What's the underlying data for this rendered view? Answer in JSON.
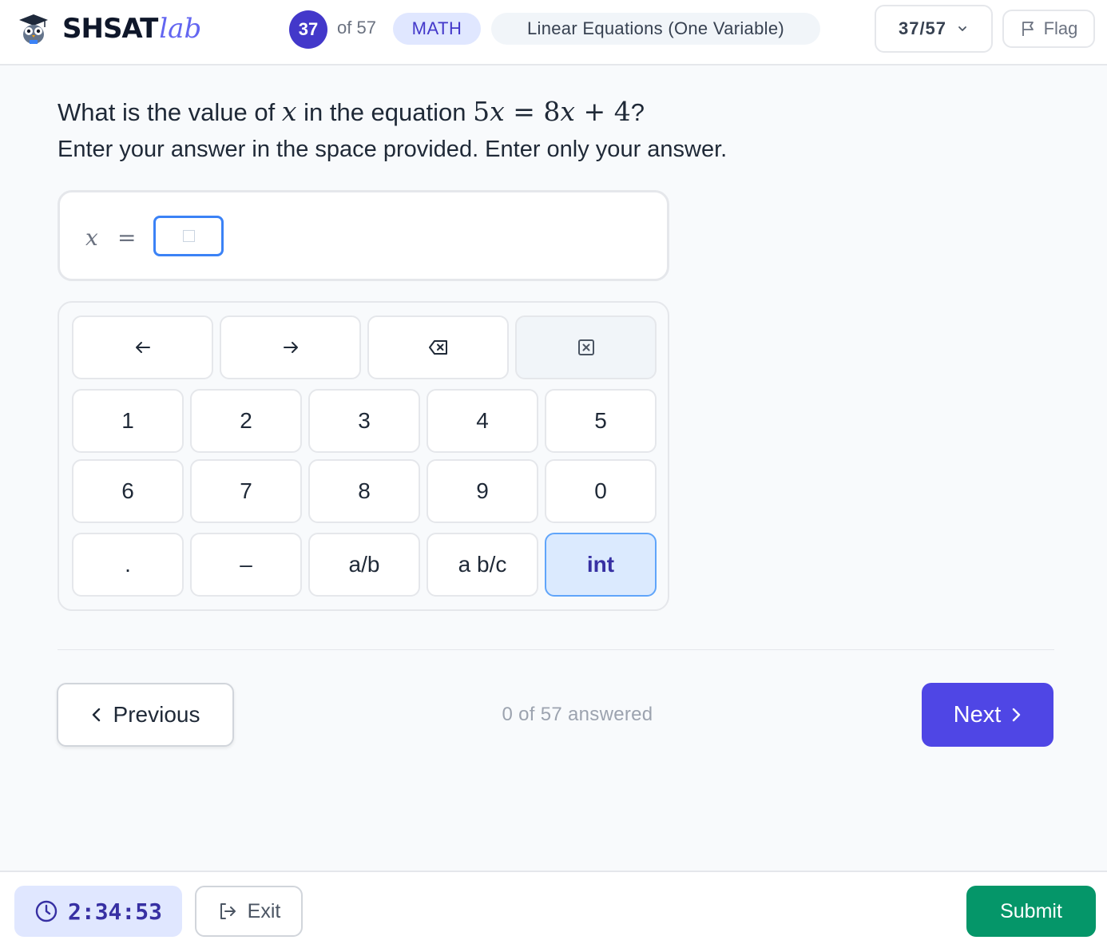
{
  "header": {
    "logo_main": "SHSAT",
    "logo_sub": "lab",
    "question_number": "37",
    "question_of": "of 57",
    "subject": "MATH",
    "topic": "Linear Equations (One Variable)",
    "nav_select": "37/57",
    "flag_label": "Flag"
  },
  "question": {
    "prefix": "What is the value of ",
    "var": "x",
    "middle": " in the equation ",
    "equation": {
      "lhs_coef": "5",
      "var": "x",
      "op": "=",
      "rhs_coef": "8",
      "plus": "+",
      "const": "4"
    },
    "suffix": "?",
    "instruction": "Enter your answer in the space provided. Enter only your answer."
  },
  "answer": {
    "variable": "x",
    "equals": "="
  },
  "keypad": {
    "row_nav": [
      "left-arrow",
      "right-arrow",
      "backspace",
      "clear"
    ],
    "rows": [
      [
        "1",
        "2",
        "3",
        "4",
        "5"
      ],
      [
        "6",
        "7",
        "8",
        "9",
        "0"
      ],
      [
        ".",
        "–",
        "a/b",
        "a b/c",
        "int"
      ]
    ],
    "active_key": "int"
  },
  "nav": {
    "previous_label": "Previous",
    "answered_text": "0 of 57 answered",
    "next_label": "Next"
  },
  "footer": {
    "timer": "2:34:53",
    "exit_label": "Exit",
    "submit_label": "Submit"
  },
  "colors": {
    "brand": "#4f46e5",
    "submit": "#059669",
    "accent_blue": "#3b82f6"
  }
}
